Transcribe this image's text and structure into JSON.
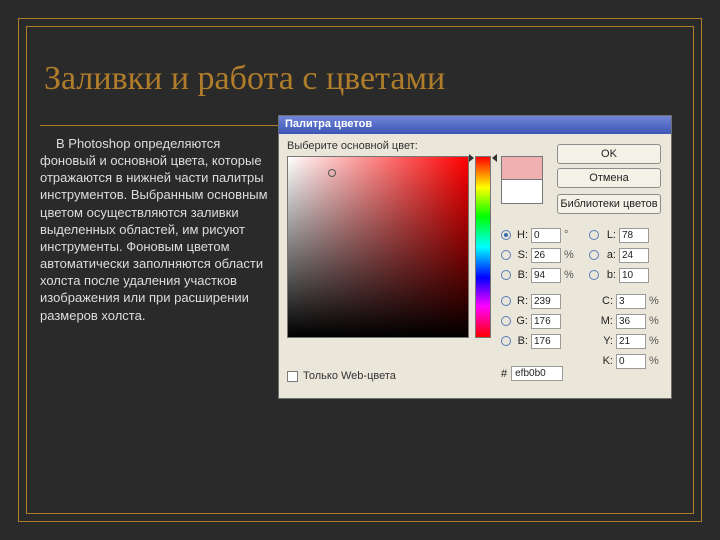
{
  "slide": {
    "title": "Заливки и работа с цветами",
    "body": "В Photoshop определяются фоновый и основной цвета, которые отражаются в нижней части палитры инструментов. Выбранным основным цветом осуществляются заливки выделенных областей, им рисуют инструменты. Фоновым цветом автоматически заполняются области холста после удаления участков изображения или при расширении размеров холста."
  },
  "picker": {
    "title": "Палитра цветов",
    "prompt": "Выберите основной цвет:",
    "buttons": {
      "ok": "OK",
      "cancel": "Отмена",
      "libraries": "Библиотеки цветов"
    },
    "hsb": {
      "h_label": "H:",
      "h_value": "0",
      "h_unit": "°",
      "s_label": "S:",
      "s_value": "26",
      "s_unit": "%",
      "b_label": "B:",
      "b_value": "94",
      "b_unit": "%"
    },
    "rgb": {
      "r_label": "R:",
      "r_value": "239",
      "g_label": "G:",
      "g_value": "176",
      "b_label": "B:",
      "b_value": "176"
    },
    "lab": {
      "l_label": "L:",
      "l_value": "78",
      "a_label": "a:",
      "a_value": "24",
      "b_label": "b:",
      "b_value": "10"
    },
    "cmyk": {
      "c_label": "C:",
      "c_value": "3",
      "c_unit": "%",
      "m_label": "M:",
      "m_value": "36",
      "m_unit": "%",
      "y_label": "Y:",
      "y_value": "21",
      "y_unit": "%",
      "k_label": "K:",
      "k_value": "0",
      "k_unit": "%"
    },
    "hex_label": "#",
    "hex_value": "efb0b0",
    "web_only": "Только Web-цвета",
    "colors": {
      "new": "#efb0b0",
      "old": "#ffffff"
    }
  }
}
